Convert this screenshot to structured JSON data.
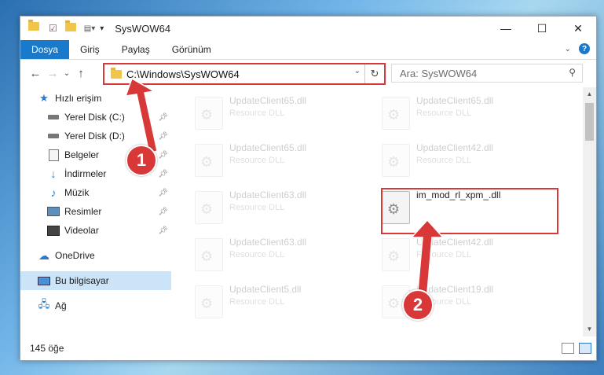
{
  "window": {
    "title": "SysWOW64",
    "controls": {
      "minimize": "—",
      "maximize": "☐",
      "close": "✕"
    }
  },
  "ribbon": {
    "tabs": [
      "Dosya",
      "Giriş",
      "Paylaş",
      "Görünüm"
    ],
    "expand_icon": "chevron-down-icon",
    "help_label": "?"
  },
  "navigation": {
    "address_path": "C:\\Windows\\SysWOW64",
    "search_placeholder": "Ara: SysWOW64"
  },
  "sidebar": {
    "quick_access": "Hızlı erişim",
    "items": [
      {
        "label": "Yerel Disk (C:)",
        "icon": "drive-icon",
        "pinned": true
      },
      {
        "label": "Yerel Disk (D:)",
        "icon": "drive-icon",
        "pinned": true
      },
      {
        "label": "Belgeler",
        "icon": "documents-icon",
        "pinned": true
      },
      {
        "label": "İndirmeler",
        "icon": "download-icon",
        "pinned": true
      },
      {
        "label": "Müzik",
        "icon": "music-icon",
        "pinned": true
      },
      {
        "label": "Resimler",
        "icon": "pictures-icon",
        "pinned": true
      },
      {
        "label": "Videolar",
        "icon": "video-icon",
        "pinned": true
      }
    ],
    "onedrive": "OneDrive",
    "this_pc": "Bu bilgisayar",
    "network": "Ağ"
  },
  "files": [
    {
      "name": "UpdateClient65.dll",
      "desc": "Resource DLL",
      "faded": true
    },
    {
      "name": "UpdateClient65.dll",
      "desc": "Resource DLL",
      "faded": true
    },
    {
      "name": "UpdateClient65.dll",
      "desc": "Resource DLL",
      "faded": true
    },
    {
      "name": "UpdateClient42.dll",
      "desc": "Resource DLL",
      "faded": true
    },
    {
      "name": "UpdateClient63.dll",
      "desc": "Resource DLL",
      "faded": true
    },
    {
      "name": "im_mod_rl_xpm_.dll",
      "desc": "",
      "faded": false
    },
    {
      "name": "UpdateClient63.dll",
      "desc": "Resource DLL",
      "faded": true
    },
    {
      "name": "UpdateClient42.dll",
      "desc": "Resource DLL",
      "faded": true
    },
    {
      "name": "UpdateClient5.dll",
      "desc": "Resource DLL",
      "faded": true
    },
    {
      "name": "UpdateClient19.dll",
      "desc": "Resource DLL",
      "faded": true
    }
  ],
  "status": {
    "count": "145 öğe"
  },
  "annotations": {
    "step1": "1",
    "step2": "2",
    "color": "#d93838"
  }
}
